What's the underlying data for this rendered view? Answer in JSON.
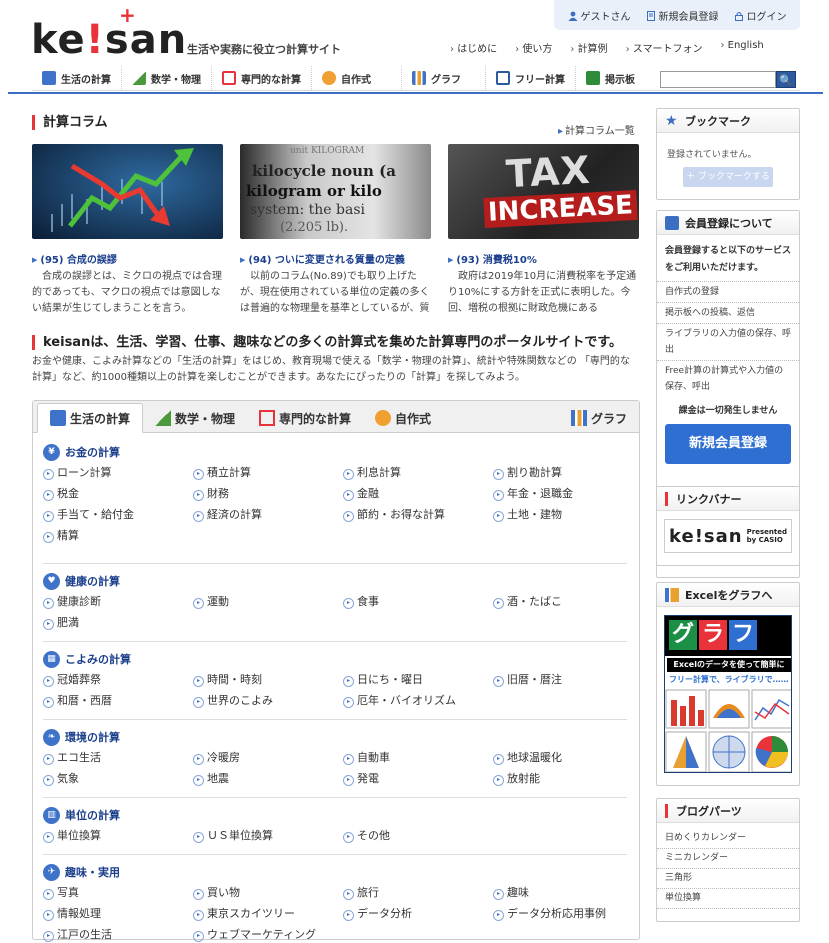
{
  "header": {
    "logo_text": "ke!san",
    "tagline": "生活や実務に役立つ計算サイト",
    "user_bar": {
      "guest": "ゲストさん",
      "register": "新規会員登録",
      "login": "ログイン"
    },
    "subnav": [
      "はじめに",
      "使い方",
      "計算例",
      "スマートフォン",
      "English"
    ],
    "mainnav": [
      {
        "label": "生活の計算",
        "color": "#3f73c9"
      },
      {
        "label": "数学・物理",
        "color": "#4a9a3c"
      },
      {
        "label": "専門的な計算",
        "color": "#e8333b"
      },
      {
        "label": "自作式",
        "color": "#f0a030"
      },
      {
        "label": "グラフ",
        "color": "#3f73c9"
      },
      {
        "label": "フリー計算",
        "color": "#2b5aa0"
      },
      {
        "label": "掲示板",
        "color": "#2e8b3a"
      }
    ],
    "search_button": "🔍"
  },
  "column": {
    "title": "計算コラム",
    "more": "計算コラム一覧",
    "cards": [
      {
        "head": "(95) 合成の誤謬",
        "text": "合成の誤謬とは、ミクロの視点では合理的であっても、マクロの視点では意図しない結果が生じてしまうことを言う。"
      },
      {
        "head": "(94) ついに変更される質量の定義",
        "text": "以前のコラム(No.89)でも取り上げたが、現在使用されている単位の定義の多くは普遍的な物理量を基準としているが、質"
      },
      {
        "head": "(93) 消費税10%",
        "text": "政府は2019年10月に消費税率を予定通り10%にする方針を正式に表明した。今回、増税の根拠に財政危機にある"
      }
    ],
    "img2_lines": [
      "unit KILOGRAM",
      "kilocycle noun (a",
      "kilogram or kilo",
      "system: the basi",
      "(2.205 lb)."
    ],
    "img3_lines": [
      "TAX",
      "INCREASE"
    ]
  },
  "intro": {
    "title": "keisanは、生活、学習、仕事、趣味などの多くの計算式を集めた計算専門のポータルサイトです。",
    "text": "お金や健康、こよみ計算などの「生活の計算」をはじめ、教育現場で使える「数学・物理の計算」、統計や特殊関数などの 「専門的な計算」など、約1000種類以上の計算を楽しむことができます。あなたにぴったりの「計算」を探してみよう。"
  },
  "tabs": [
    "生活の計算",
    "数学・物理",
    "専門的な計算",
    "自作式",
    "グラフ"
  ],
  "categories": [
    {
      "title": "お金の計算",
      "icon": "¥",
      "links": [
        "ローン計算",
        "積立計算",
        "利息計算",
        "割り勘計算",
        "税金",
        "財務",
        "金融",
        "年金・退職金",
        "手当て・給付金",
        "経済の計算",
        "節約・お得な計算",
        "土地・建物",
        "精算"
      ]
    },
    {
      "title": "健康の計算",
      "icon": "♥",
      "links": [
        "健康診断",
        "運動",
        "食事",
        "酒・たばこ",
        "肥満"
      ]
    },
    {
      "title": "こよみの計算",
      "icon": "▦",
      "links": [
        "冠婚葬祭",
        "時間・時刻",
        "日にち・曜日",
        "旧暦・暦注",
        "和暦・西暦",
        "世界のこよみ",
        "厄年・バイオリズム"
      ]
    },
    {
      "title": "環境の計算",
      "icon": "❧",
      "links": [
        "エコ生活",
        "冷暖房",
        "自動車",
        "地球温暖化",
        "気象",
        "地震",
        "発電",
        "放射能"
      ]
    },
    {
      "title": "単位の計算",
      "icon": "▥",
      "links": [
        "単位換算",
        "ＵＳ単位換算",
        "その他"
      ]
    },
    {
      "title": "趣味・実用",
      "icon": "✈",
      "links": [
        "写真",
        "買い物",
        "旅行",
        "趣味",
        "情報処理",
        "東京スカイツリー",
        "データ分析",
        "データ分析応用事例",
        "江戸の生活",
        "ウェブマーケティング"
      ]
    }
  ],
  "sidebar": {
    "bookmark": {
      "title": "ブックマーク",
      "empty": "登録されていません。",
      "button": "＋ ブックマークする"
    },
    "member": {
      "title": "会員登録について",
      "desc": "会員登録すると以下のサービスをご利用いただけます。",
      "items": [
        "自作式の登録",
        "掲示板への投稿、返信",
        "ライブラリの入力値の保存、呼出",
        "Free計算の計算式や入力値の保存、呼出"
      ],
      "free": "課金は一切発生しません",
      "button": "新規会員登録"
    },
    "link_banner": {
      "title": "リンクバナー",
      "logo": "ke!san",
      "presented": "Presented",
      "by": "by CASIO"
    },
    "excel": {
      "title": "Excelをグラフへ",
      "g1": "グ",
      "g2": "ラ",
      "g3": "フ",
      "line1": "Excelのデータを使って簡単に",
      "line2": "フリー計算で、ライブラリで……"
    },
    "blog": {
      "title": "ブログパーツ",
      "items": [
        "日めくりカレンダー",
        "ミニカレンダー",
        "三角形",
        "単位換算"
      ]
    }
  }
}
